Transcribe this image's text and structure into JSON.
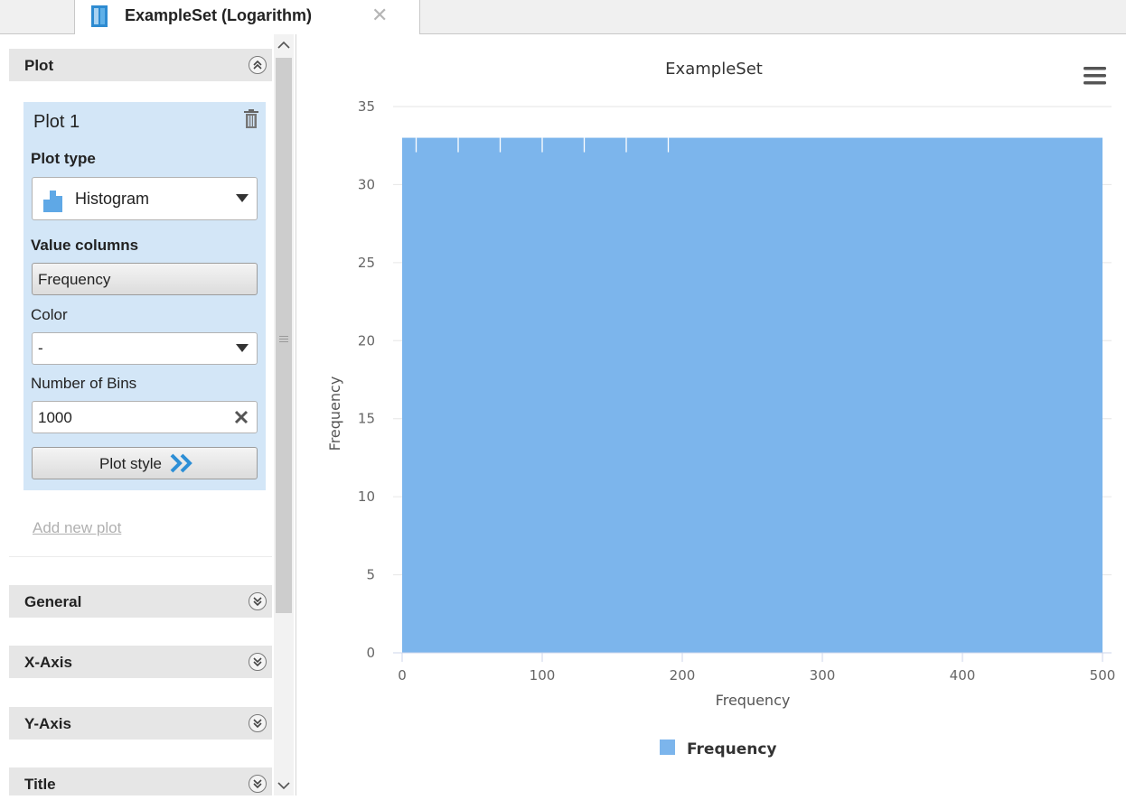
{
  "tab": {
    "title": "ExampleSet (Logarithm)",
    "close_symbol": "✕"
  },
  "sidebar": {
    "plot_section": {
      "title": "Plot"
    },
    "plot_card": {
      "title": "Plot 1",
      "plot_type_label": "Plot type",
      "plot_type_value": "Histogram",
      "value_columns_label": "Value columns",
      "value_columns_value": "Frequency",
      "color_label": "Color",
      "color_value": "-",
      "bins_label": "Number of Bins",
      "bins_value": "1000",
      "plot_style_label": "Plot style"
    },
    "add_plot_label": "Add new plot",
    "sections": [
      {
        "title": "General"
      },
      {
        "title": "X-Axis"
      },
      {
        "title": "Y-Axis"
      },
      {
        "title": "Title"
      }
    ]
  },
  "colors": {
    "bar": "#7cb5ec",
    "card": "#d3e6f7",
    "accent": "#2d8fd6"
  },
  "chart_data": {
    "type": "bar",
    "title": "ExampleSet",
    "xlabel": "Frequency",
    "ylabel": "Frequency",
    "x_ticks": [
      0,
      100,
      200,
      300,
      400,
      500
    ],
    "y_ticks": [
      0,
      5,
      10,
      15,
      20,
      25,
      30,
      35
    ],
    "xlim": [
      0,
      500
    ],
    "ylim": [
      0,
      35
    ],
    "bar_range": [
      0,
      500
    ],
    "bar_height": 33,
    "bin_gap_ticks": [
      10,
      40,
      70,
      100,
      130,
      160,
      190
    ],
    "series": [
      {
        "name": "Frequency",
        "color": "#7cb5ec"
      }
    ],
    "grid": "horizontal",
    "legend": "bottom-center"
  }
}
